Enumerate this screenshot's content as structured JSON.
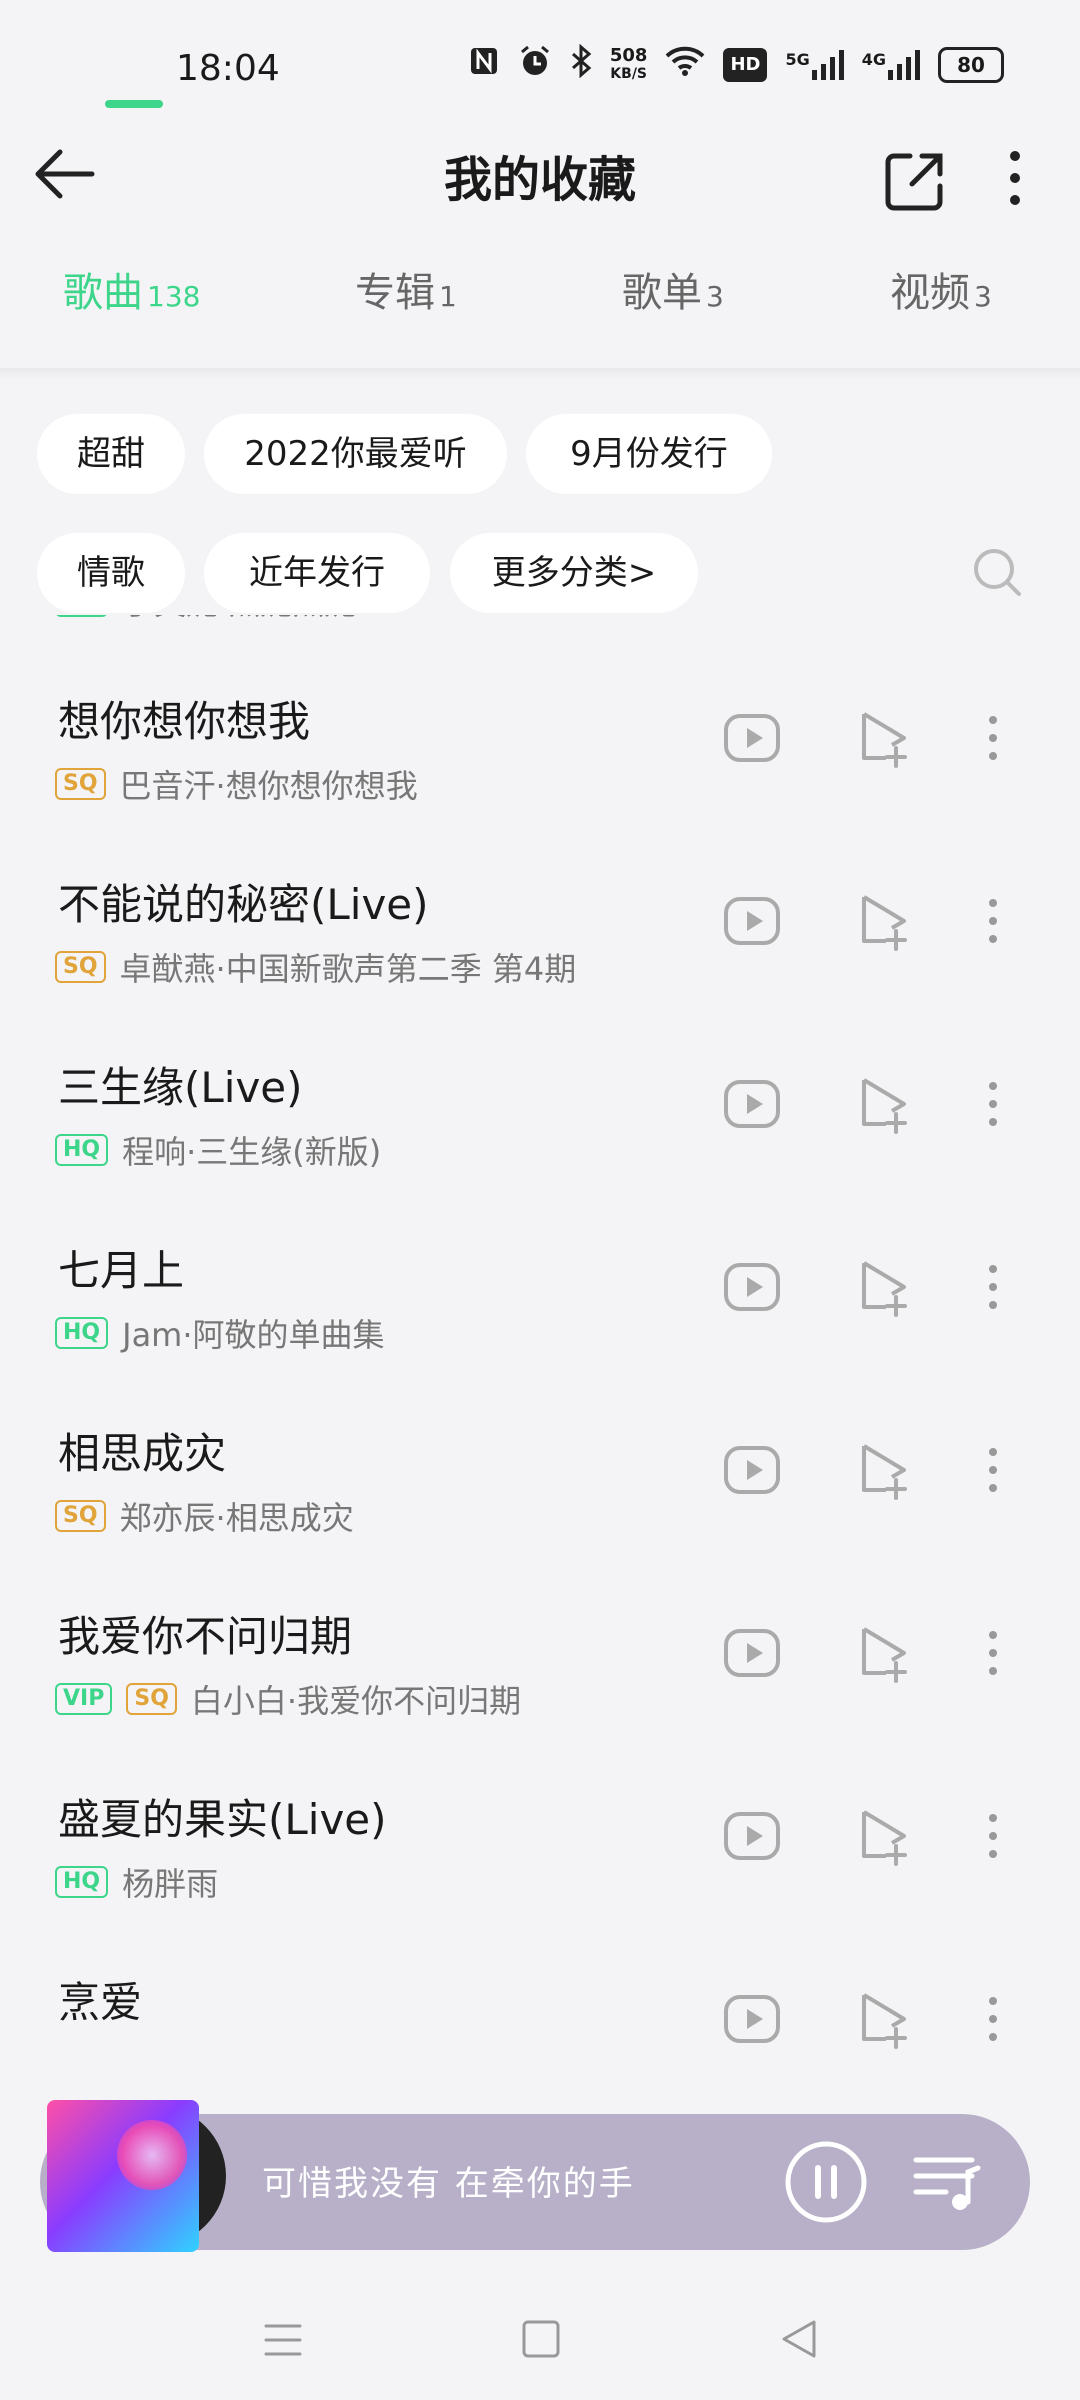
{
  "status_bar": {
    "time": "18:04",
    "net_speed_value": "508",
    "net_speed_unit": "KB/S",
    "hd_label": "HD",
    "sig1_label": "5G",
    "sig2_label": "4G",
    "battery": "80"
  },
  "header": {
    "title": "我的收藏"
  },
  "tabs": [
    {
      "label": "歌曲",
      "count": "138"
    },
    {
      "label": "专辑",
      "count": "1"
    },
    {
      "label": "歌单",
      "count": "3"
    },
    {
      "label": "视频",
      "count": "3"
    }
  ],
  "chips": [
    "超甜",
    "2022你最爱听",
    "9月份发行",
    "情歌",
    "近年发行",
    "更多分类>"
  ],
  "songs": [
    {
      "title": "",
      "badges": [
        "HQ"
      ],
      "artist": "丁芙妮·杰妮杰妮"
    },
    {
      "title": "想你想你想我",
      "badges": [
        "SQ"
      ],
      "artist": "巴音汗·想你想你想我"
    },
    {
      "title": "不能说的秘密(Live)",
      "badges": [
        "SQ"
      ],
      "artist": "卓猷燕·中国新歌声第二季 第4期"
    },
    {
      "title": "三生缘(Live)",
      "badges": [
        "HQ"
      ],
      "artist": "程响·三生缘(新版)"
    },
    {
      "title": "七月上",
      "badges": [
        "HQ"
      ],
      "artist": "Jam·阿敬的单曲集"
    },
    {
      "title": "相思成灾",
      "badges": [
        "SQ"
      ],
      "artist": "郑亦辰·相思成灾"
    },
    {
      "title": "我爱你不问归期",
      "badges": [
        "VIP",
        "SQ"
      ],
      "artist": "白小白·我爱你不问归期"
    },
    {
      "title": "盛夏的果实(Live)",
      "badges": [
        "HQ"
      ],
      "artist": "杨胖雨"
    },
    {
      "title": "烹爱",
      "badges": [],
      "artist": ""
    }
  ],
  "player": {
    "now_playing": "可惜我没有 在牵你的手"
  },
  "colors": {
    "accent": "#3dd58a",
    "sq": "#e0a43a",
    "player_bg": "#b7b0c8",
    "background": "#f4f4f6"
  }
}
